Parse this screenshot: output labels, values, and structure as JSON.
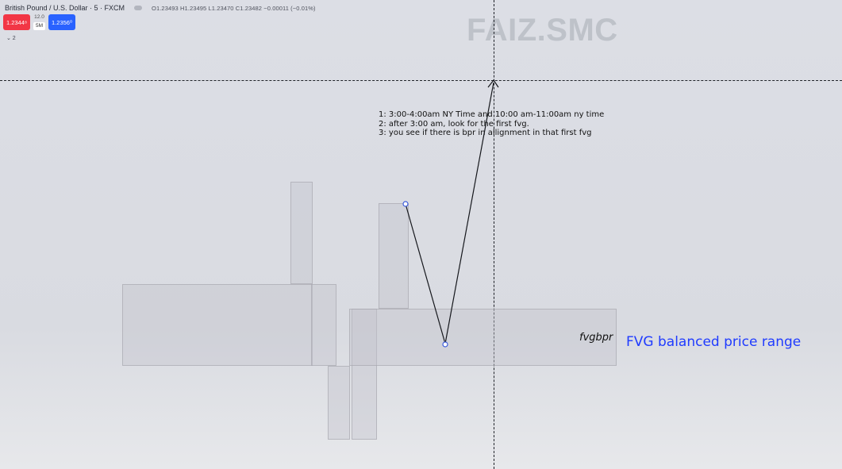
{
  "header": {
    "symbol_title": "British Pound / U.S. Dollar · 5 · FXCM",
    "ohlc": "O1.23493  H1.23495  L1.23470  C1.23482  −0.00011 (−0.01%)"
  },
  "trade": {
    "sell_price": "1.2344⁸",
    "spread": "12.0",
    "quantity": "5M",
    "buy_price": "1.2356⁰"
  },
  "indicators": {
    "toggle_label": "⌄ 2"
  },
  "watermark": "FAIZ.SMC",
  "notes": [
    "1: 3:00-4:00am NY Time and 10:00 am-11:00am ny time",
    "2: after 3:00 am, look for the first fvg.",
    "3: you see if there is bpr in allignment in that first fvg"
  ],
  "labels": {
    "fvgbpr": "fvgbpr",
    "fvg_range": "FVG balanced price range"
  },
  "colors": {
    "sell": "#f23645",
    "buy": "#2962ff",
    "annotation_blue": "#1f3bff",
    "anchor_point": "#3b5bdb"
  }
}
